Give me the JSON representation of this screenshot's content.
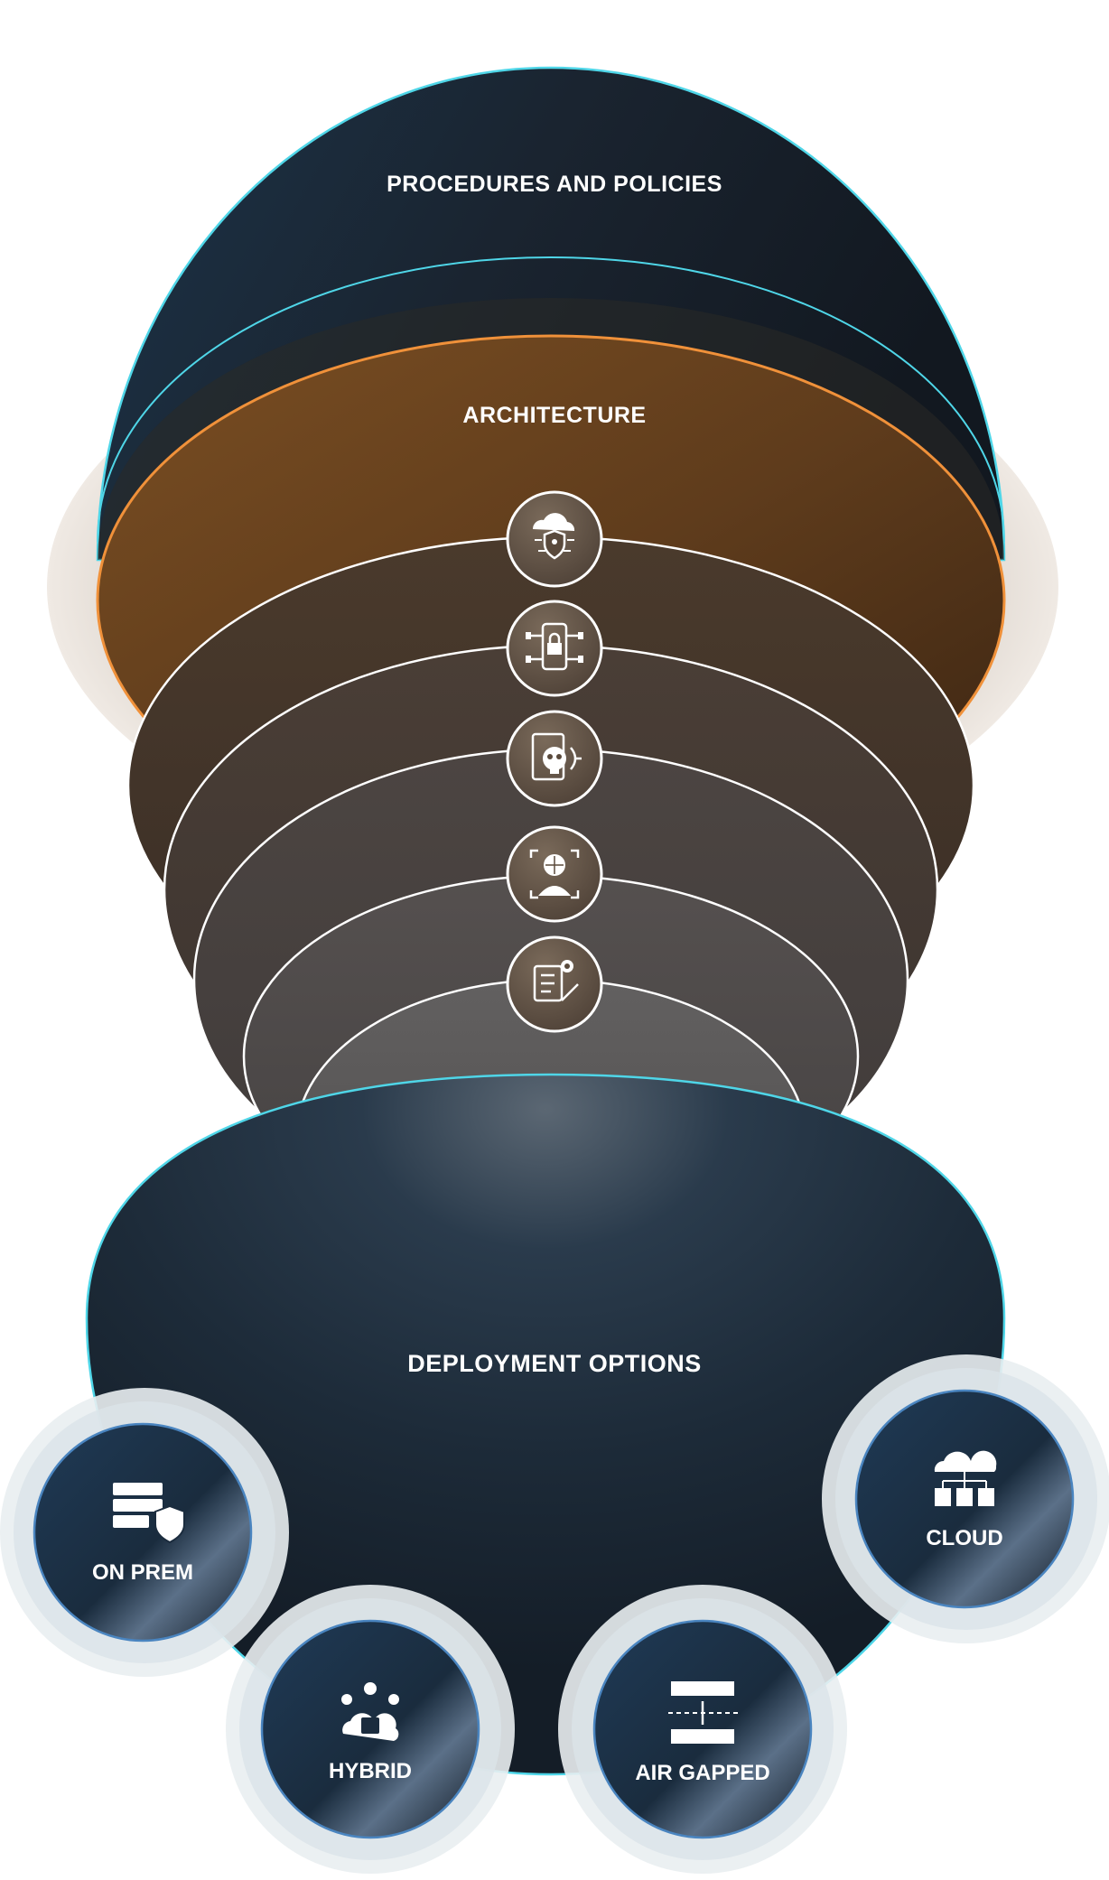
{
  "layers": {
    "procedures": "PROCEDURES AND POLICIES",
    "architecture": "ARCHITECTURE"
  },
  "ring_icons": [
    "cloud-shield-network-icon",
    "mobile-lock-circuit-icon",
    "malware-skull-icon",
    "facial-recognition-icon",
    "checklist-gear-icon"
  ],
  "deployment": {
    "title": "DEPLOYMENT OPTIONS",
    "options": [
      {
        "label": "ON PREM",
        "icon": "server-shield-icon"
      },
      {
        "label": "HYBRID",
        "icon": "cloud-lock-network-icon"
      },
      {
        "label": "AIR GAPPED",
        "icon": "air-gap-transfer-icon"
      },
      {
        "label": "CLOUD",
        "icon": "cloud-servers-icon"
      }
    ]
  },
  "colors": {
    "cyan_outline": "#4fd6e8",
    "orange_outline": "#f0913a",
    "navy": "#1b2838",
    "brown": "#5a3a1e"
  }
}
